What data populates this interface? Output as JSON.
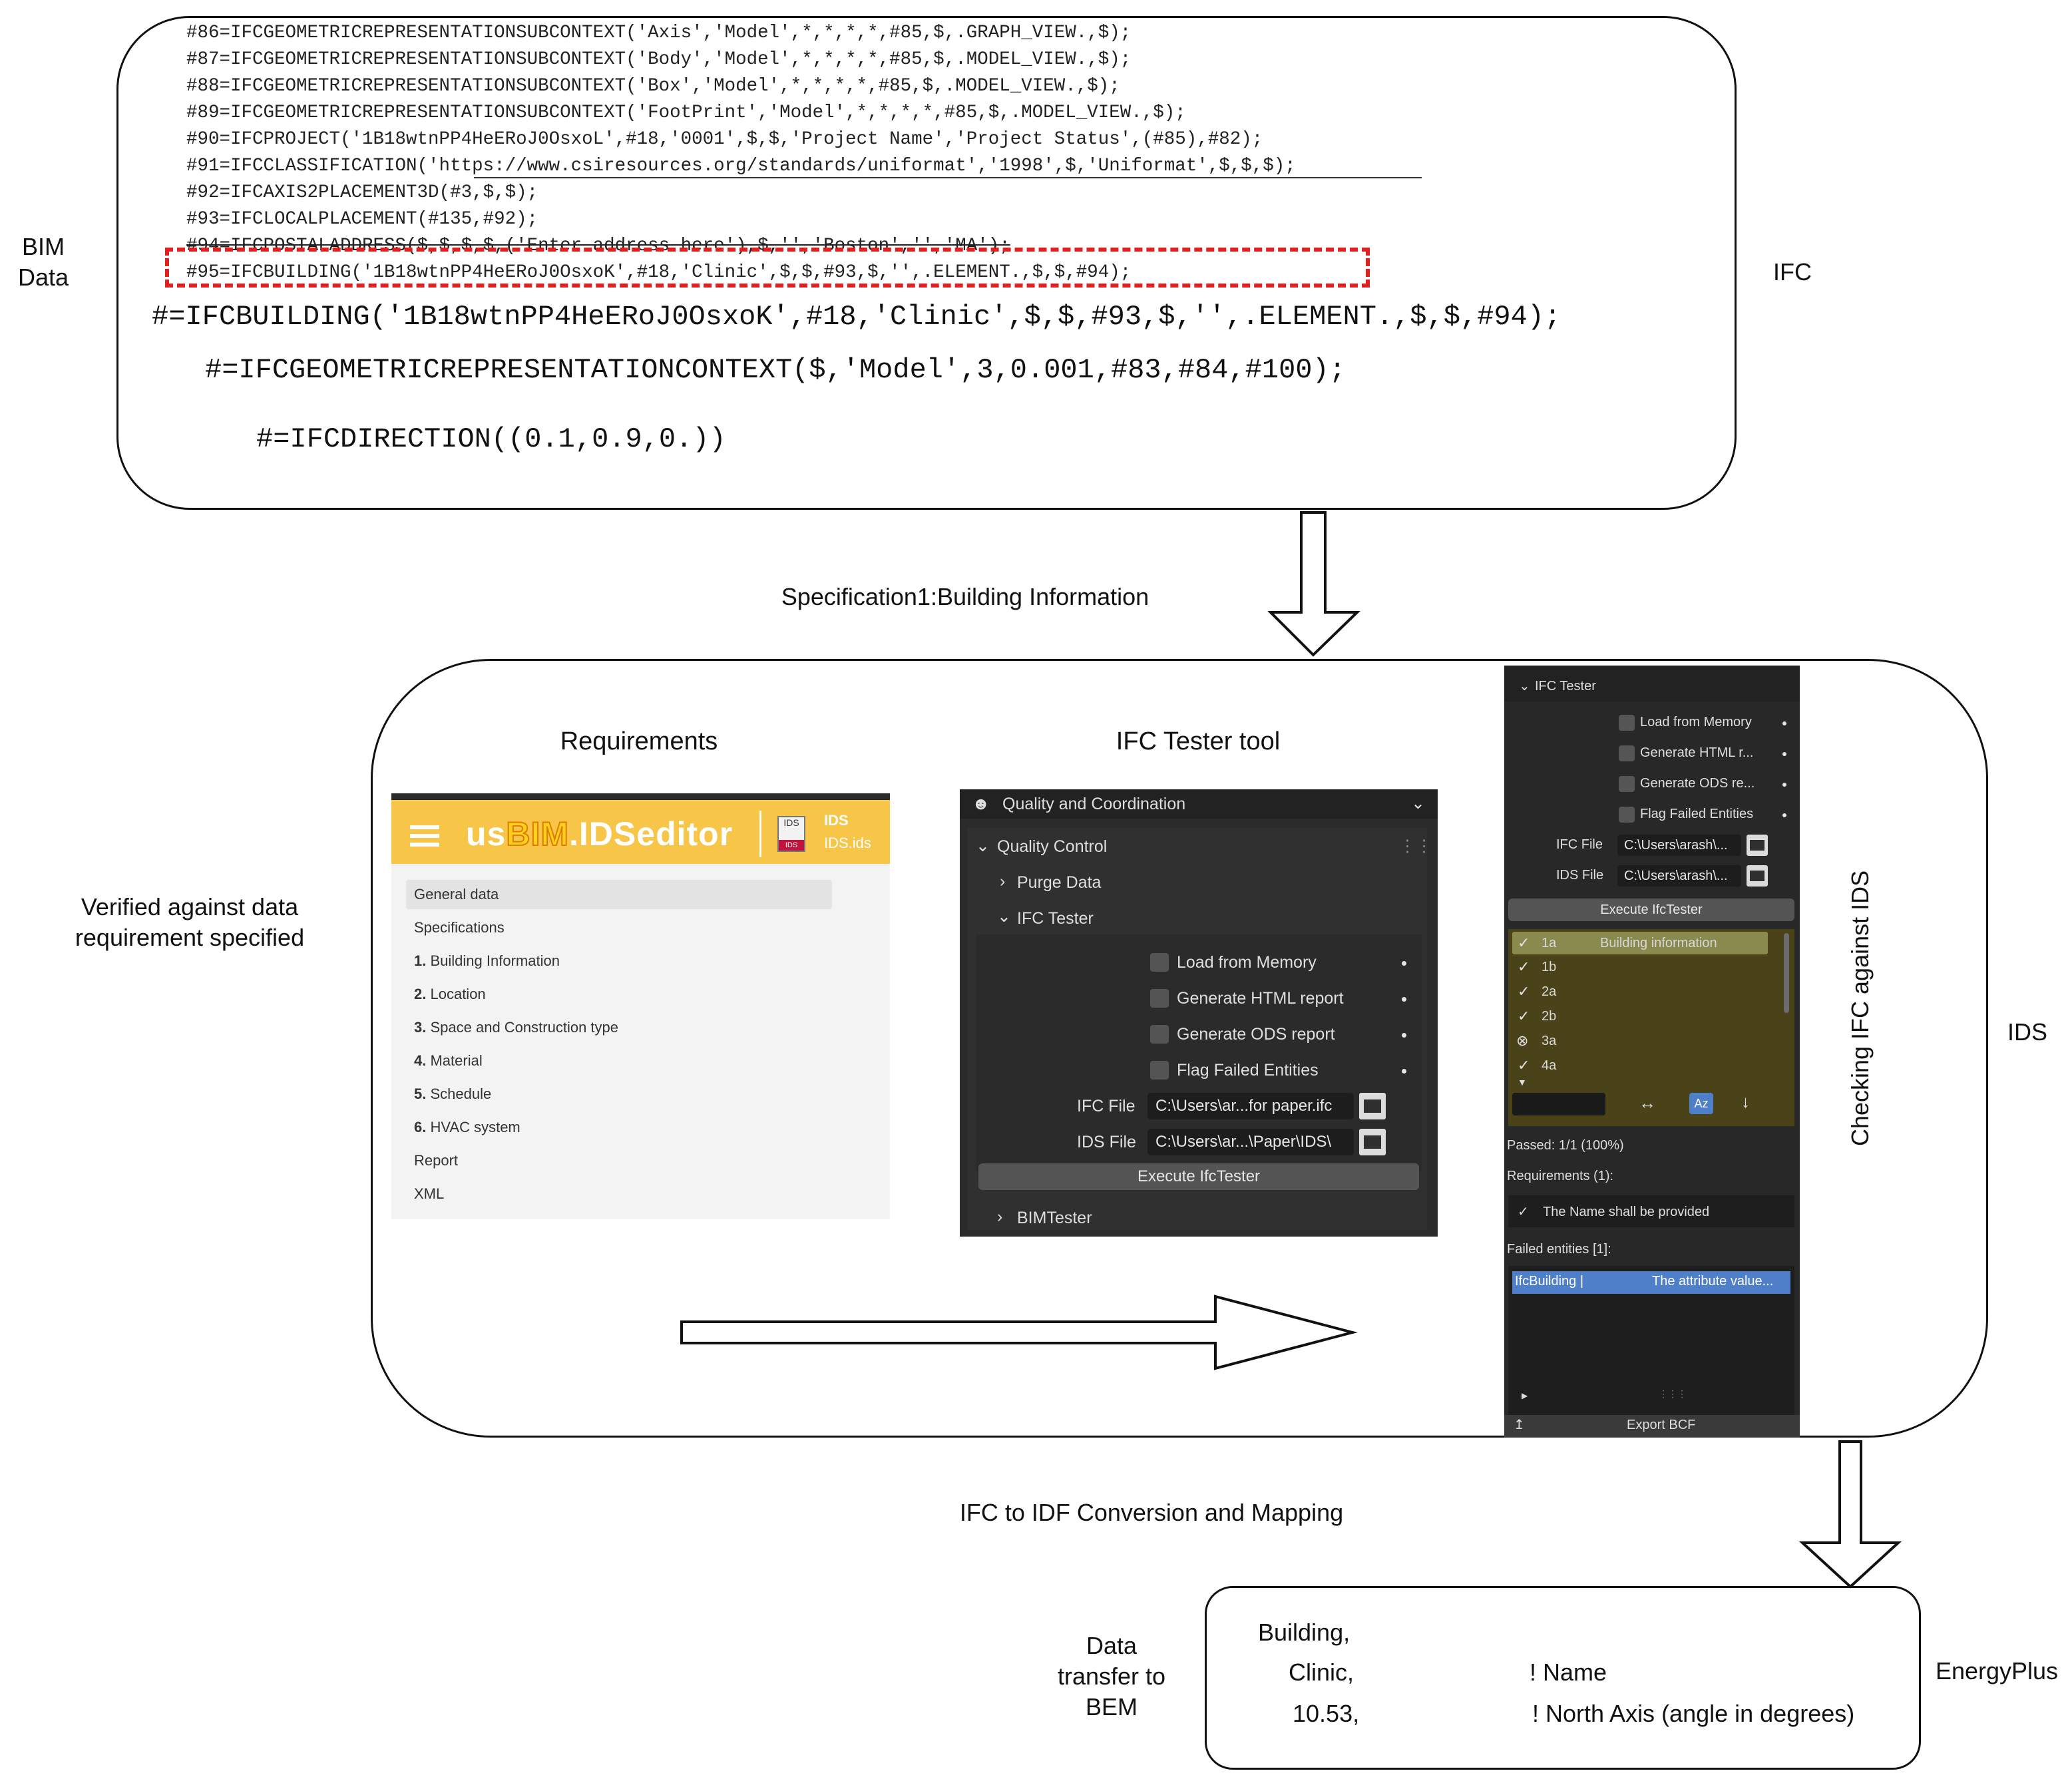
{
  "labels": {
    "bim_data": "BIM\nData",
    "ifc": "IFC",
    "spec_caption": "Specification1:Building Information",
    "verified": "Verified against data\nrequirement specified",
    "requirements_title": "Requirements",
    "tester_title": "IFC Tester tool",
    "ids": "IDS",
    "checking": "Checking IFC against IDS",
    "conversion_caption": "IFC to IDF Conversion and Mapping",
    "data_transfer": "Data\ntransfer to\nBEM",
    "energyplus": "EnergyPlus"
  },
  "ifc_code": {
    "lines": [
      "#86=IFCGEOMETRICREPRESENTATIONSUBCONTEXT('Axis','Model',*,*,*,*,#85,$,.GRAPH_VIEW.,$);",
      "#87=IFCGEOMETRICREPRESENTATIONSUBCONTEXT('Body','Model',*,*,*,*,#85,$,.MODEL_VIEW.,$);",
      "#88=IFCGEOMETRICREPRESENTATIONSUBCONTEXT('Box','Model',*,*,*,*,#85,$,.MODEL_VIEW.,$);",
      "#89=IFCGEOMETRICREPRESENTATIONSUBCONTEXT('FootPrint','Model',*,*,*,*,#85,$,.MODEL_VIEW.,$);",
      "#90=IFCPROJECT('1B18wtnPP4HeERoJ0OsxoL',#18,'0001',$,$,'Project Name','Project Status',(#85),#82);",
      "#91=IFCCLASSIFICATION('https://www.csiresources.org/standards/uniformat','1998',$,'Uniformat',$,$,$);",
      "#92=IFCAXIS2PLACEMENT3D(#3,$,$);",
      "#93=IFCLOCALPLACEMENT(#135,#92);",
      "#94=IFCPOSTALADDRESS($,$,$,$,('Enter address here'),$,'','Boston','','MA');",
      "#95=IFCBUILDING('1B18wtnPP4HeERoJ0OsxoK',#18,'Clinic',$,$,#93,$,'',.ELEMENT.,$,$,#94);"
    ],
    "big1": "#=IFCBUILDING('1B18wtnPP4HeERoJ0OsxoK',#18,'Clinic',$,$,#93,$,'',.ELEMENT.,$,$,#94);",
    "big2": "#=IFCGEOMETRICREPRESENTATIONCONTEXT($,'Model',3,0.001,#83,#84,#100);",
    "big3": "#=IFCDIRECTION((0.1,0.9,0.))"
  },
  "ids_editor": {
    "logo_a": "us",
    "logo_b": "BIM",
    "logo_c": ".IDSeditor",
    "file_icon_top": "IDS",
    "file_icon_bottom": "IDS",
    "file_type": "IDS",
    "file_name": "IDS.ids",
    "items": [
      {
        "num": "",
        "label": "General data"
      },
      {
        "num": "",
        "label": "Specifications"
      },
      {
        "num": "1.",
        "label": "Building Information"
      },
      {
        "num": "2.",
        "label": "Location"
      },
      {
        "num": "3.",
        "label": "Space and Construction type"
      },
      {
        "num": "4.",
        "label": "Material"
      },
      {
        "num": "5.",
        "label": "Schedule"
      },
      {
        "num": "6.",
        "label": "HVAC system"
      },
      {
        "num": "",
        "label": "Report"
      },
      {
        "num": "",
        "label": "XML"
      }
    ]
  },
  "tester_panel": {
    "header": "Quality and Coordination",
    "quality_control": "Quality Control",
    "purge_data": "Purge Data",
    "ifc_tester": "IFC Tester",
    "opt1": "Load from Memory",
    "opt2": "Generate HTML report",
    "opt3": "Generate ODS report",
    "opt4": "Flag Failed Entities",
    "ifc_file_label": "IFC File",
    "ifc_file_value": "C:\\Users\\ar...for paper.ifc",
    "ids_file_label": "IDS File",
    "ids_file_value": "C:\\Users\\ar...\\Paper\\IDS\\",
    "execute": "Execute IfcTester",
    "bimtester": "BIMTester"
  },
  "result_panel": {
    "header": "IFC Tester",
    "opt1": "Load from Memory",
    "opt2": "Generate HTML r...",
    "opt3": "Generate ODS re...",
    "opt4": "Flag Failed Entities",
    "ifc_file_label": "IFC File",
    "ifc_file_value": "C:\\Users\\arash\\...",
    "ids_file_label": "IDS File",
    "ids_file_value": "C:\\Users\\arash\\...",
    "execute": "Execute IfcTester",
    "specs": [
      {
        "mark": "✓",
        "id": "1a",
        "name": "Building information"
      },
      {
        "mark": "✓",
        "id": "1b",
        "name": ""
      },
      {
        "mark": "✓",
        "id": "2a",
        "name": ""
      },
      {
        "mark": "✓",
        "id": "2b",
        "name": ""
      },
      {
        "mark": "⊗",
        "id": "3a",
        "name": ""
      },
      {
        "mark": "✓",
        "id": "4a",
        "name": ""
      }
    ],
    "passed": "Passed: 1/1 (100%)",
    "requirements": "Requirements (1):",
    "req1": "The Name shall be provided",
    "failed": "Failed entities [1]:",
    "failed_entity": "IfcBuilding |",
    "failed_msg": "The attribute value...",
    "export": "Export BCF"
  },
  "energyplus": {
    "line1": "Building,",
    "line2": "Clinic,",
    "line3": "10.53,",
    "comment2": "! Name",
    "comment3": "! North Axis (angle in degrees)"
  },
  "colors": {
    "dashed_highlight": "#e0201e",
    "ids_yellow": "#f7c548",
    "dark_panel": "#282828",
    "list_olive": "#4a4218",
    "selected_row": "#8a8a4e",
    "failed_row": "#4f7fc9"
  }
}
